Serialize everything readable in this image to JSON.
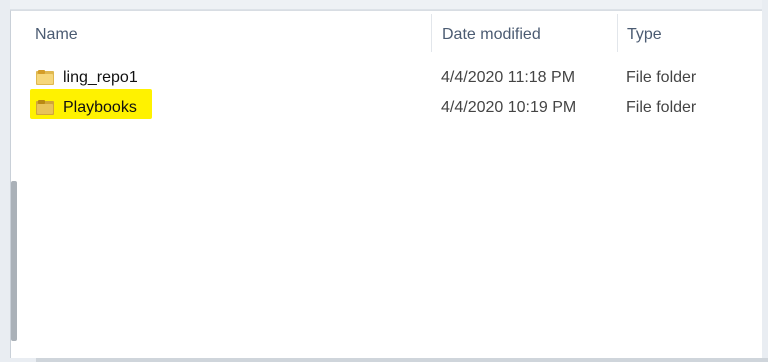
{
  "columns": {
    "name": "Name",
    "date_modified": "Date modified",
    "type": "Type"
  },
  "rows": [
    {
      "name": "ling_repo1",
      "date_modified": "4/4/2020 11:18 PM",
      "type": "File folder",
      "icon": "folder-icon"
    },
    {
      "name": "Playbooks",
      "date_modified": "4/4/2020 10:19 PM",
      "type": "File folder",
      "icon": "folder-icon",
      "highlight_color": "#fff200"
    }
  ],
  "ui": {
    "sort_indicator": "sort-asc-icon",
    "accent_color": "#fff200"
  }
}
